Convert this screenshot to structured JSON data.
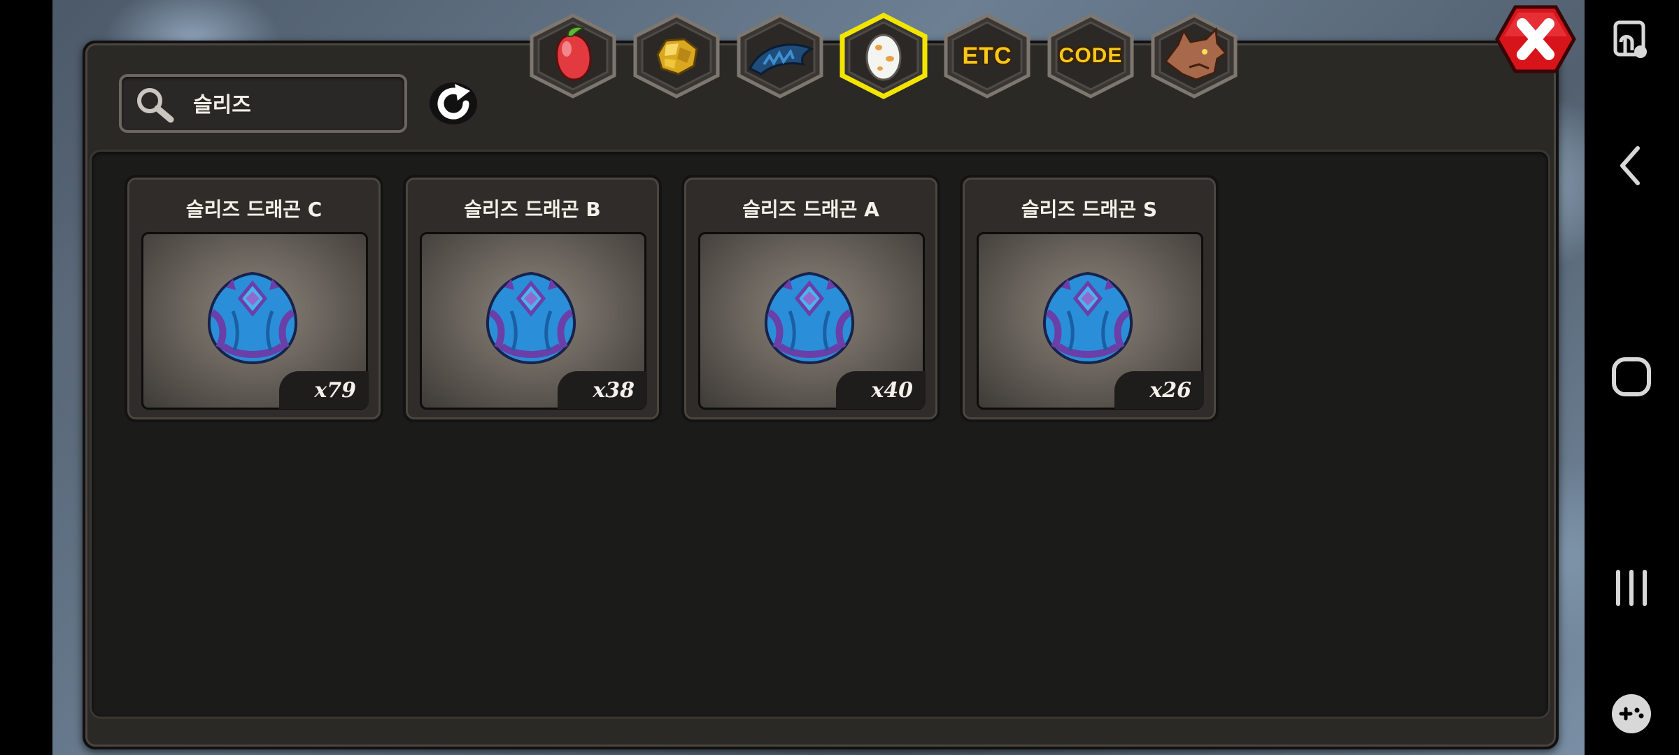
{
  "search": {
    "value": "슬리즈",
    "placeholder": ""
  },
  "tabs": [
    {
      "name": "fruit",
      "label": "",
      "icon": "fruit-icon",
      "selected": false
    },
    {
      "name": "gold",
      "label": "",
      "icon": "gold-nugget-icon",
      "selected": false
    },
    {
      "name": "dragon-scale",
      "label": "",
      "icon": "dragon-scale-icon",
      "selected": false
    },
    {
      "name": "egg",
      "label": "",
      "icon": "egg-icon",
      "selected": true
    },
    {
      "name": "etc",
      "label": "ETC",
      "icon": "",
      "selected": false
    },
    {
      "name": "code",
      "label": "CODE",
      "icon": "",
      "selected": false
    },
    {
      "name": "dragon",
      "label": "",
      "icon": "dragon-head-icon",
      "selected": false
    }
  ],
  "items": [
    {
      "name": "슬리즈 드래곤 C",
      "count": "x79"
    },
    {
      "name": "슬리즈 드래곤 B",
      "count": "x38"
    },
    {
      "name": "슬리즈 드래곤 A",
      "count": "x40"
    },
    {
      "name": "슬리즈 드래곤 S",
      "count": "x26"
    }
  ],
  "colors": {
    "panel": "#2b2926",
    "inner_panel": "#1b1b1a",
    "selected_tab_outline": "#f2e600",
    "tab_text": "#f6c81b",
    "close_button": "#d8141b",
    "egg_blue": "#2a8fd8",
    "egg_purple": "#6a3fa8"
  },
  "system_nav": [
    "screenshot-icon",
    "back-icon",
    "home-icon",
    "recents-icon",
    "game-tools-icon"
  ]
}
